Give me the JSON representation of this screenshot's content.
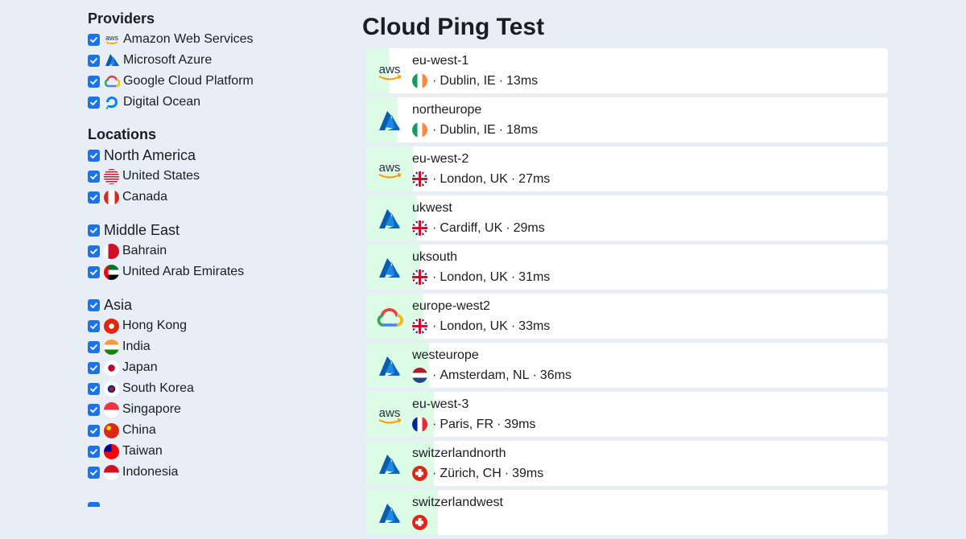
{
  "sidebar": {
    "providers_title": "Providers",
    "providers": [
      {
        "label": "Amazon Web Services",
        "icon": "aws-icon"
      },
      {
        "label": "Microsoft Azure",
        "icon": "azure-icon"
      },
      {
        "label": "Google Cloud Platform",
        "icon": "gcp-icon"
      },
      {
        "label": "Digital Ocean",
        "icon": "digitalocean-icon"
      }
    ],
    "locations_title": "Locations",
    "regions": [
      {
        "label": "North America",
        "countries": [
          {
            "label": "United States",
            "flag": "us-flag-icon"
          },
          {
            "label": "Canada",
            "flag": "ca-flag-icon"
          }
        ]
      },
      {
        "label": "Middle East",
        "countries": [
          {
            "label": "Bahrain",
            "flag": "bh-flag-icon"
          },
          {
            "label": "United Arab Emirates",
            "flag": "ae-flag-icon"
          }
        ]
      },
      {
        "label": "Asia",
        "countries": [
          {
            "label": "Hong Kong",
            "flag": "hk-flag-icon"
          },
          {
            "label": "India",
            "flag": "in-flag-icon"
          },
          {
            "label": "Japan",
            "flag": "jp-flag-icon"
          },
          {
            "label": "South Korea",
            "flag": "kr-flag-icon"
          },
          {
            "label": "Singapore",
            "flag": "sg-flag-icon"
          },
          {
            "label": "China",
            "flag": "cn-flag-icon"
          },
          {
            "label": "Taiwan",
            "flag": "tw-flag-icon"
          },
          {
            "label": "Indonesia",
            "flag": "id-flag-icon"
          }
        ]
      }
    ]
  },
  "main": {
    "title": "Cloud Ping Test",
    "results": [
      {
        "provider": "aws",
        "region": "eu-west-1",
        "flag": "ie-flag-icon",
        "location": "Dublin, IE",
        "latency": "13ms",
        "ms": 13
      },
      {
        "provider": "azure",
        "region": "northeurope",
        "flag": "ie-flag-icon",
        "location": "Dublin, IE",
        "latency": "18ms",
        "ms": 18
      },
      {
        "provider": "aws",
        "region": "eu-west-2",
        "flag": "gb-flag-icon",
        "location": "London, UK",
        "latency": "27ms",
        "ms": 27
      },
      {
        "provider": "azure",
        "region": "ukwest",
        "flag": "gb-flag-icon",
        "location": "Cardiff, UK",
        "latency": "29ms",
        "ms": 29
      },
      {
        "provider": "azure",
        "region": "uksouth",
        "flag": "gb-flag-icon",
        "location": "London, UK",
        "latency": "31ms",
        "ms": 31
      },
      {
        "provider": "gcp",
        "region": "europe-west2",
        "flag": "gb-flag-icon",
        "location": "London, UK",
        "latency": "33ms",
        "ms": 33
      },
      {
        "provider": "azure",
        "region": "westeurope",
        "flag": "nl-flag-icon",
        "location": "Amsterdam, NL",
        "latency": "36ms",
        "ms": 36
      },
      {
        "provider": "aws",
        "region": "eu-west-3",
        "flag": "fr-flag-icon",
        "location": "Paris, FR",
        "latency": "39ms",
        "ms": 39
      },
      {
        "provider": "azure",
        "region": "switzerlandnorth",
        "flag": "ch-flag-icon",
        "location": "Zürich, CH",
        "latency": "39ms",
        "ms": 39
      },
      {
        "provider": "azure",
        "region": "switzerlandwest",
        "flag": "ch-flag-icon",
        "location": "",
        "latency": "",
        "ms": 41
      }
    ]
  },
  "colors": {
    "accent": "#1a73e8",
    "latency_bar": "#dcfce5",
    "background": "#e8eef5"
  }
}
